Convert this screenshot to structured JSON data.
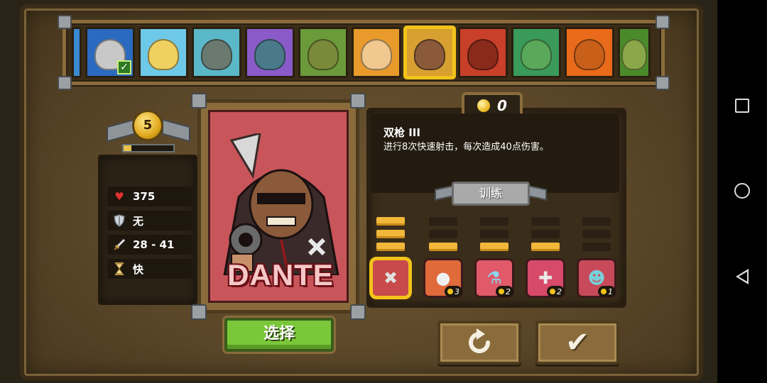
{
  "level": {
    "value": "5",
    "xp_progress": 0.15
  },
  "stats": [
    {
      "icon": "heart-icon",
      "value": "375"
    },
    {
      "icon": "shield-icon",
      "value": "无"
    },
    {
      "icon": "sword-icon",
      "value": "28 - 41"
    },
    {
      "icon": "hourglass-icon",
      "value": "快"
    }
  ],
  "hero": {
    "name": "DANTE"
  },
  "select_button": "选择",
  "gold": {
    "value": "0"
  },
  "skill": {
    "title": "双枪 III",
    "description": "进行8次快速射击，每次造成40点伤害。",
    "train_label": "训练"
  },
  "skills": [
    {
      "name": "dual-pistols",
      "level": 3,
      "max": 4,
      "cost": ""
    },
    {
      "name": "grenade",
      "level": 1,
      "max": 4,
      "cost": "3"
    },
    {
      "name": "potion",
      "level": 1,
      "max": 4,
      "cost": "2"
    },
    {
      "name": "holy-cross",
      "level": 1,
      "max": 4,
      "cost": "2"
    },
    {
      "name": "hunter-mask",
      "level": 0,
      "max": 4,
      "cost": "1"
    }
  ],
  "colors": {
    "accent": "#f2c31a",
    "select_green": "#7ac83a",
    "panel_wood": "#5a4628"
  }
}
